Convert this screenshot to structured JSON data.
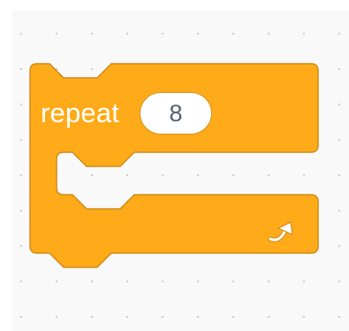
{
  "workspace": {
    "dot_color": "#c9ccd3",
    "background": "#f9f9f9"
  },
  "repeat_block": {
    "label": "repeat",
    "count": "8",
    "fill_color": "#ffab19",
    "border_color": "#cf8b17",
    "loop_icon": "rotate-right-arrow-icon"
  }
}
